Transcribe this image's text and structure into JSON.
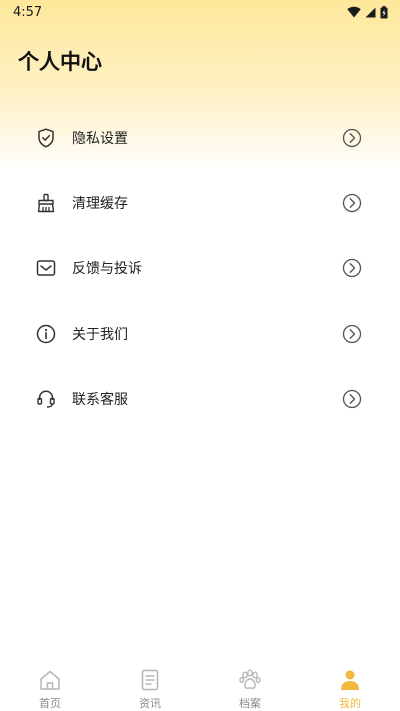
{
  "status_bar": {
    "time": "4:57"
  },
  "header": {
    "title": "个人中心"
  },
  "menu": {
    "items": [
      {
        "label": "隐私设置",
        "icon": "shield-icon"
      },
      {
        "label": "清理缓存",
        "icon": "broom-icon"
      },
      {
        "label": "反馈与投诉",
        "icon": "mail-icon"
      },
      {
        "label": "关于我们",
        "icon": "info-icon"
      },
      {
        "label": "联系客服",
        "icon": "headset-icon"
      }
    ]
  },
  "tabbar": {
    "tabs": [
      {
        "label": "首页",
        "icon": "home-icon",
        "active": false
      },
      {
        "label": "资讯",
        "icon": "news-icon",
        "active": false
      },
      {
        "label": "档案",
        "icon": "paw-icon",
        "active": false
      },
      {
        "label": "我的",
        "icon": "user-icon",
        "active": true
      }
    ]
  },
  "colors": {
    "accent": "#f0b93e",
    "header_gradient_top": "#fde89a"
  }
}
